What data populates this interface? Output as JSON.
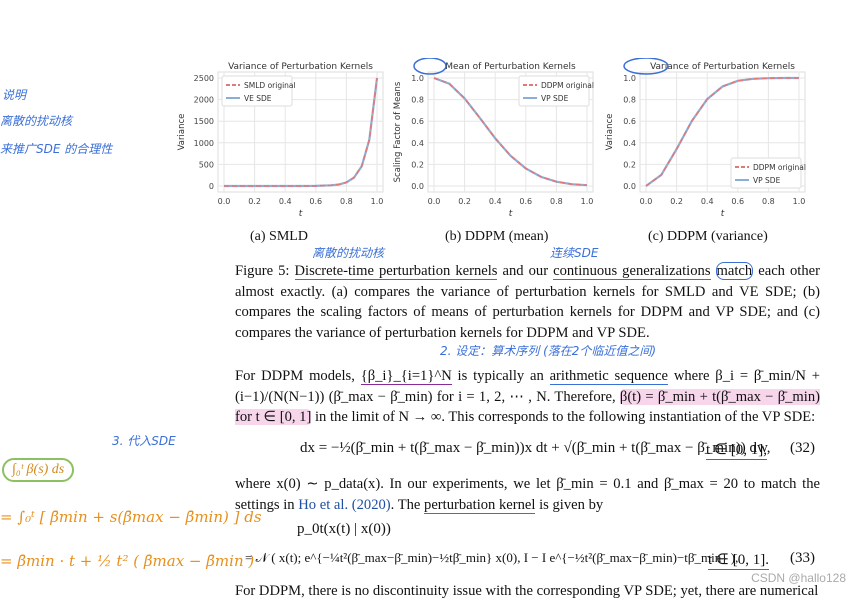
{
  "colors": {
    "original": "#e07a7a",
    "sde": "#8aaed8",
    "annotation_blue": "#3a6fd8",
    "annotation_orange": "#e8901c",
    "highlight": "#f7d6ec"
  },
  "chart_data": [
    {
      "type": "line",
      "title": "Variance of Perturbation Kernels",
      "xlabel": "t",
      "ylabel": "Variance",
      "xlim": [
        0,
        1
      ],
      "ylim": [
        0,
        2500
      ],
      "xticks": [
        "0.0",
        "0.2",
        "0.4",
        "0.6",
        "0.8",
        "1.0"
      ],
      "yticks": [
        "0",
        "500",
        "1000",
        "1500",
        "2000",
        "2500"
      ],
      "grid": true,
      "legend": "top-left",
      "x": [
        0,
        0.1,
        0.2,
        0.3,
        0.4,
        0.5,
        0.6,
        0.7,
        0.75,
        0.8,
        0.85,
        0.9,
        0.95,
        1.0
      ],
      "series": [
        {
          "name": "SMLD original",
          "style": "dashed",
          "values": [
            0.0001,
            0.00055,
            0.003,
            0.017,
            0.091,
            0.5,
            2.75,
            15.1,
            35.4,
            82.8,
            194,
            455,
            1066,
            2500
          ]
        },
        {
          "name": "VE SDE",
          "style": "solid",
          "values": [
            0.0001,
            0.00055,
            0.003,
            0.017,
            0.091,
            0.5,
            2.75,
            15.1,
            35.4,
            82.8,
            194,
            455,
            1066,
            2500
          ]
        }
      ]
    },
    {
      "type": "line",
      "title": "Mean of Perturbation Kernels",
      "xlabel": "t",
      "ylabel": "Scaling Factor of Means",
      "xlim": [
        0,
        1
      ],
      "ylim": [
        0,
        1
      ],
      "xticks": [
        "0.0",
        "0.2",
        "0.4",
        "0.6",
        "0.8",
        "1.0"
      ],
      "yticks": [
        "0.0",
        "0.2",
        "0.4",
        "0.6",
        "0.8",
        "1.0"
      ],
      "grid": true,
      "legend": "top-right",
      "x": [
        0,
        0.1,
        0.2,
        0.3,
        0.4,
        0.5,
        0.6,
        0.7,
        0.8,
        0.9,
        1.0
      ],
      "series": [
        {
          "name": "DDPM original",
          "style": "dashed",
          "values": [
            1,
            0.947,
            0.811,
            0.63,
            0.442,
            0.281,
            0.162,
            0.084,
            0.04,
            0.017,
            0.007
          ]
        },
        {
          "name": "VP SDE",
          "style": "solid",
          "values": [
            1,
            0.947,
            0.811,
            0.63,
            0.442,
            0.281,
            0.162,
            0.084,
            0.04,
            0.017,
            0.007
          ]
        }
      ]
    },
    {
      "type": "line",
      "title": "Variance of Perturbation Kernels",
      "xlabel": "t",
      "ylabel": "Variance",
      "xlim": [
        0,
        1
      ],
      "ylim": [
        0,
        1
      ],
      "xticks": [
        "0.0",
        "0.2",
        "0.4",
        "0.6",
        "0.8",
        "1.0"
      ],
      "yticks": [
        "0.0",
        "0.2",
        "0.4",
        "0.6",
        "0.8",
        "1.0"
      ],
      "grid": true,
      "legend": "bottom-right",
      "x": [
        0,
        0.1,
        0.2,
        0.3,
        0.4,
        0.5,
        0.6,
        0.7,
        0.8,
        0.9,
        1.0
      ],
      "series": [
        {
          "name": "DDPM original",
          "style": "dashed",
          "values": [
            0,
            0.103,
            0.342,
            0.603,
            0.805,
            0.921,
            0.974,
            0.993,
            0.998,
            1,
            1
          ]
        },
        {
          "name": "VP SDE",
          "style": "solid",
          "values": [
            0,
            0.103,
            0.342,
            0.603,
            0.805,
            0.921,
            0.974,
            0.993,
            0.998,
            1,
            1
          ]
        }
      ]
    }
  ],
  "subcaptions": [
    "(a) SMLD",
    "(b) DDPM (mean)",
    "(c) DDPM (variance)"
  ],
  "caption": {
    "label": "Figure 5:",
    "u1": "Discrete-time perturbation kernels",
    "t1": " and our ",
    "u2": "continuous generalizations",
    "t2": " ",
    "u3": "match",
    "t3": " each other almost exactly.  (a) compares the variance of perturbation kernels for SMLD and VE SDE; (b) compares the scaling factors of means of perturbation kernels for DDPM and VP SDE; and (c) compares the variance of perturbation kernels for DDPM and VP SDE."
  },
  "para1": {
    "a": "For DDPM models, ",
    "seq": "{β_i}_{i=1}^N",
    "b": " is typically an ",
    "u": "arithmetic sequence",
    "c": " where β_i = β̄_min/N + (i−1)/(N(N−1)) (β̄_max − β̄_min) for i = 1, 2, ⋯ , N. Therefore, ",
    "hl": "β(t) = β̄_min + t(β̄_max − β̄_min) for t ∈ [0, 1]",
    "d": " in the limit of N → ∞. This corresponds to the following instantiation of the VP SDE:"
  },
  "eq32": {
    "body": "dx = −½(β̄_min + t(β̄_max − β̄_min))x dt + √(β̄_min + t(β̄_max − β̄_min)) dw,",
    "cond": "t ∈ [0, 1],",
    "num": "(32)"
  },
  "para2": {
    "a": "where x(0) ∼ p_data(x). In our experiments, we let β̄_min = 0.1 and β̄_max = 20 to match the settings in ",
    "link": "Ho et al. (2020)",
    "b": ". The ",
    "u": "perturbation kernel",
    "c": " is given by"
  },
  "eq33": {
    "lhs": "p_0t(x(t) | x(0))",
    "rhs": "= 𝒩 ( x(t); e^{−¼t²(β̄_max−β̄_min)−½tβ̄_min} x(0), I − I e^{−½t²(β̄_max−β̄_min)−tβ̄_min} ),",
    "cond": "t ∈ [0, 1].",
    "num": "(33)"
  },
  "para3": "For DDPM, there is no discontinuity issue with the corresponding VP SDE; yet, there are numerical",
  "annotations": {
    "left_notes": [
      "说明",
      "离散的扰动核",
      "来推广SDE 的合理性"
    ],
    "above_discrete": "离散的扰动核",
    "above_continuous": "连续SDE",
    "step2": "2. 设定：算术序列 (落在2个临近值之间)",
    "step3": "3. 代入SDE",
    "integral": "∫₀ᵗ β(s) ds",
    "line2": "= ∫₀ᵗ [ β̄min + s(β̄max − β̄min) ] ds",
    "line3": "= β̄min · t + ½ t² ( β̄max − β̄min )"
  },
  "watermark": "CSDN @hallo128"
}
